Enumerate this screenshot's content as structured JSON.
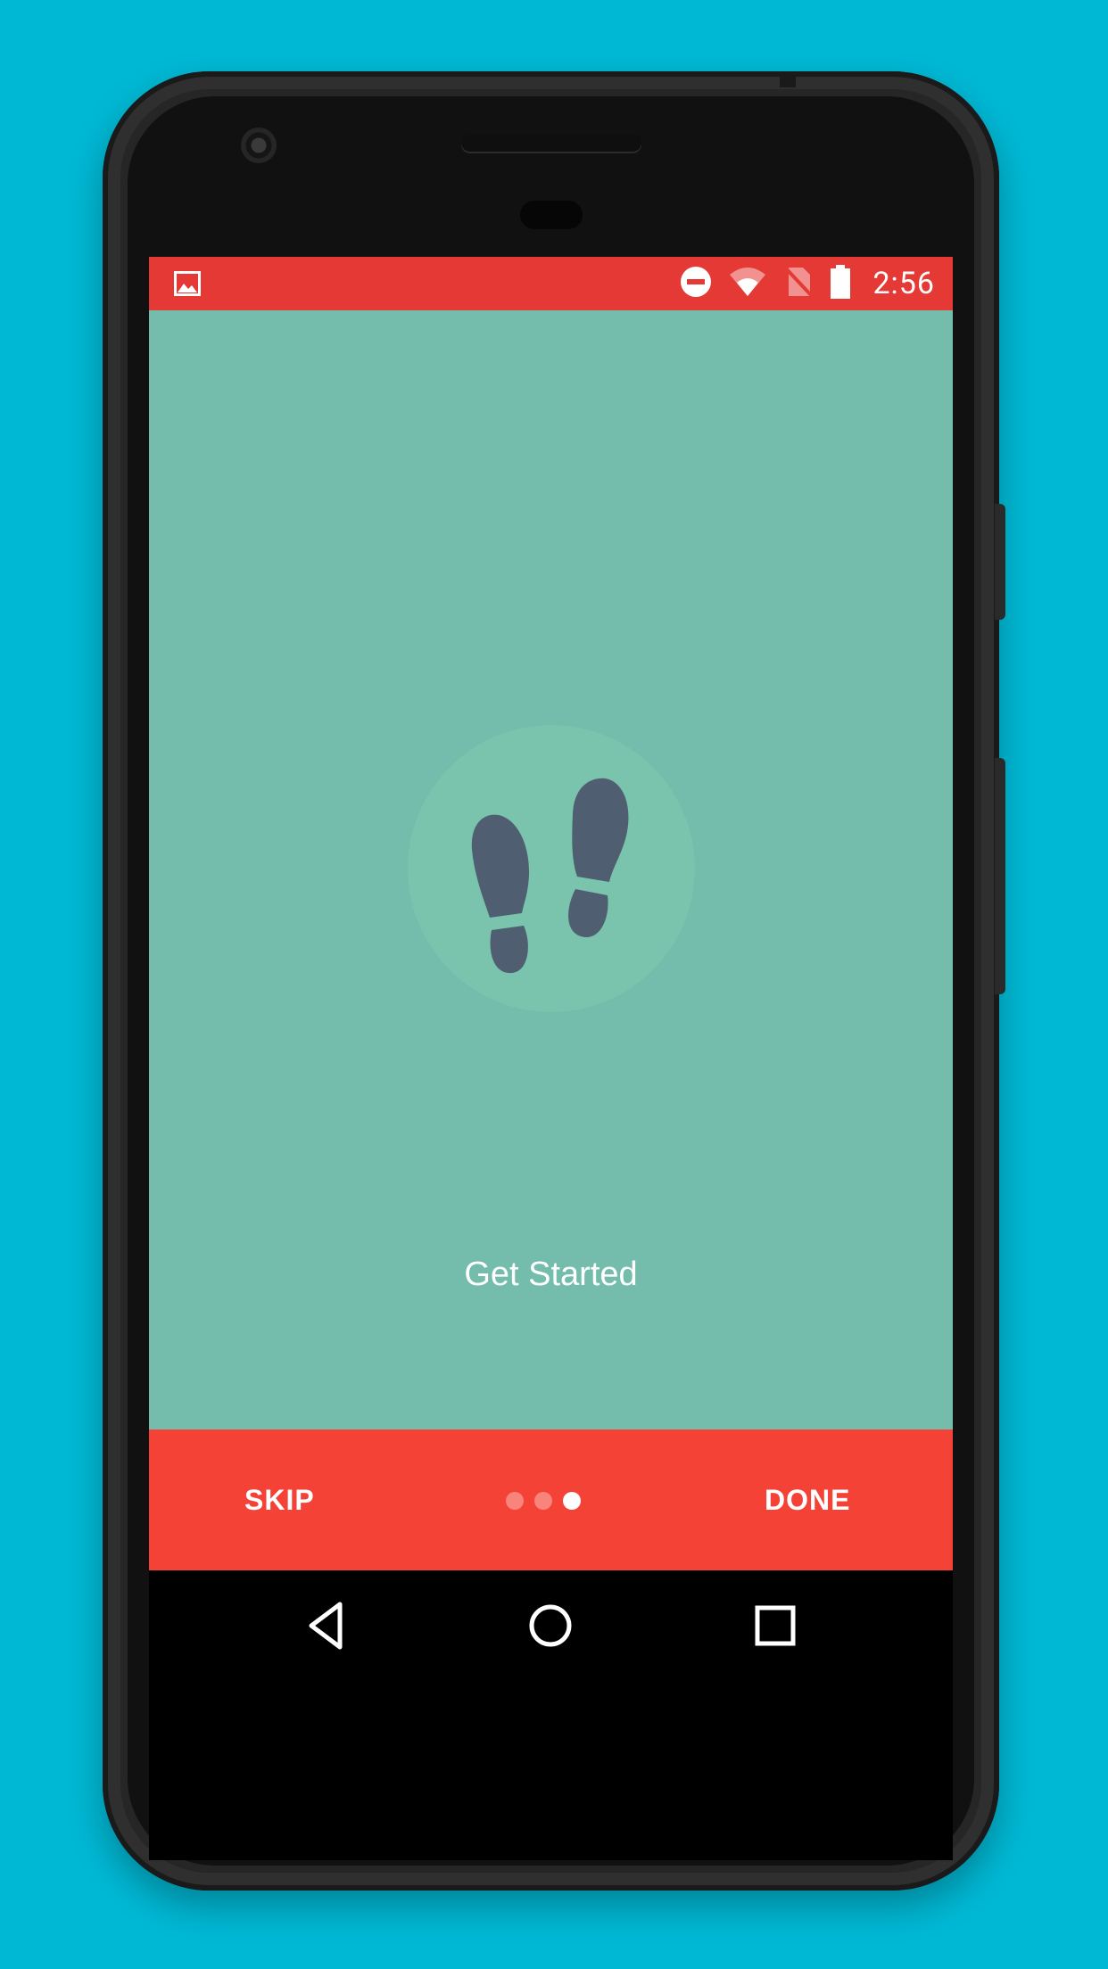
{
  "colors": {
    "background": "#00b8d4",
    "status_bar": "#e53935",
    "screen_bg": "#74bcab",
    "hero_circle": "#7ac3ad",
    "footprint": "#505e72",
    "bottom_bar": "#f44336"
  },
  "status_bar": {
    "left_icon": "image-icon",
    "icons": [
      "do-not-disturb-icon",
      "wifi-icon",
      "no-sim-icon",
      "battery-icon"
    ],
    "time": "2:56"
  },
  "onboarding": {
    "icon": "footprints-icon",
    "title": "Get Started",
    "page_index": 3,
    "page_count": 3
  },
  "controls": {
    "skip_label": "SKIP",
    "done_label": "DONE"
  },
  "nav_bar": {
    "back_icon": "back-triangle-icon",
    "home_icon": "home-circle-icon",
    "recents_icon": "recents-square-icon"
  }
}
